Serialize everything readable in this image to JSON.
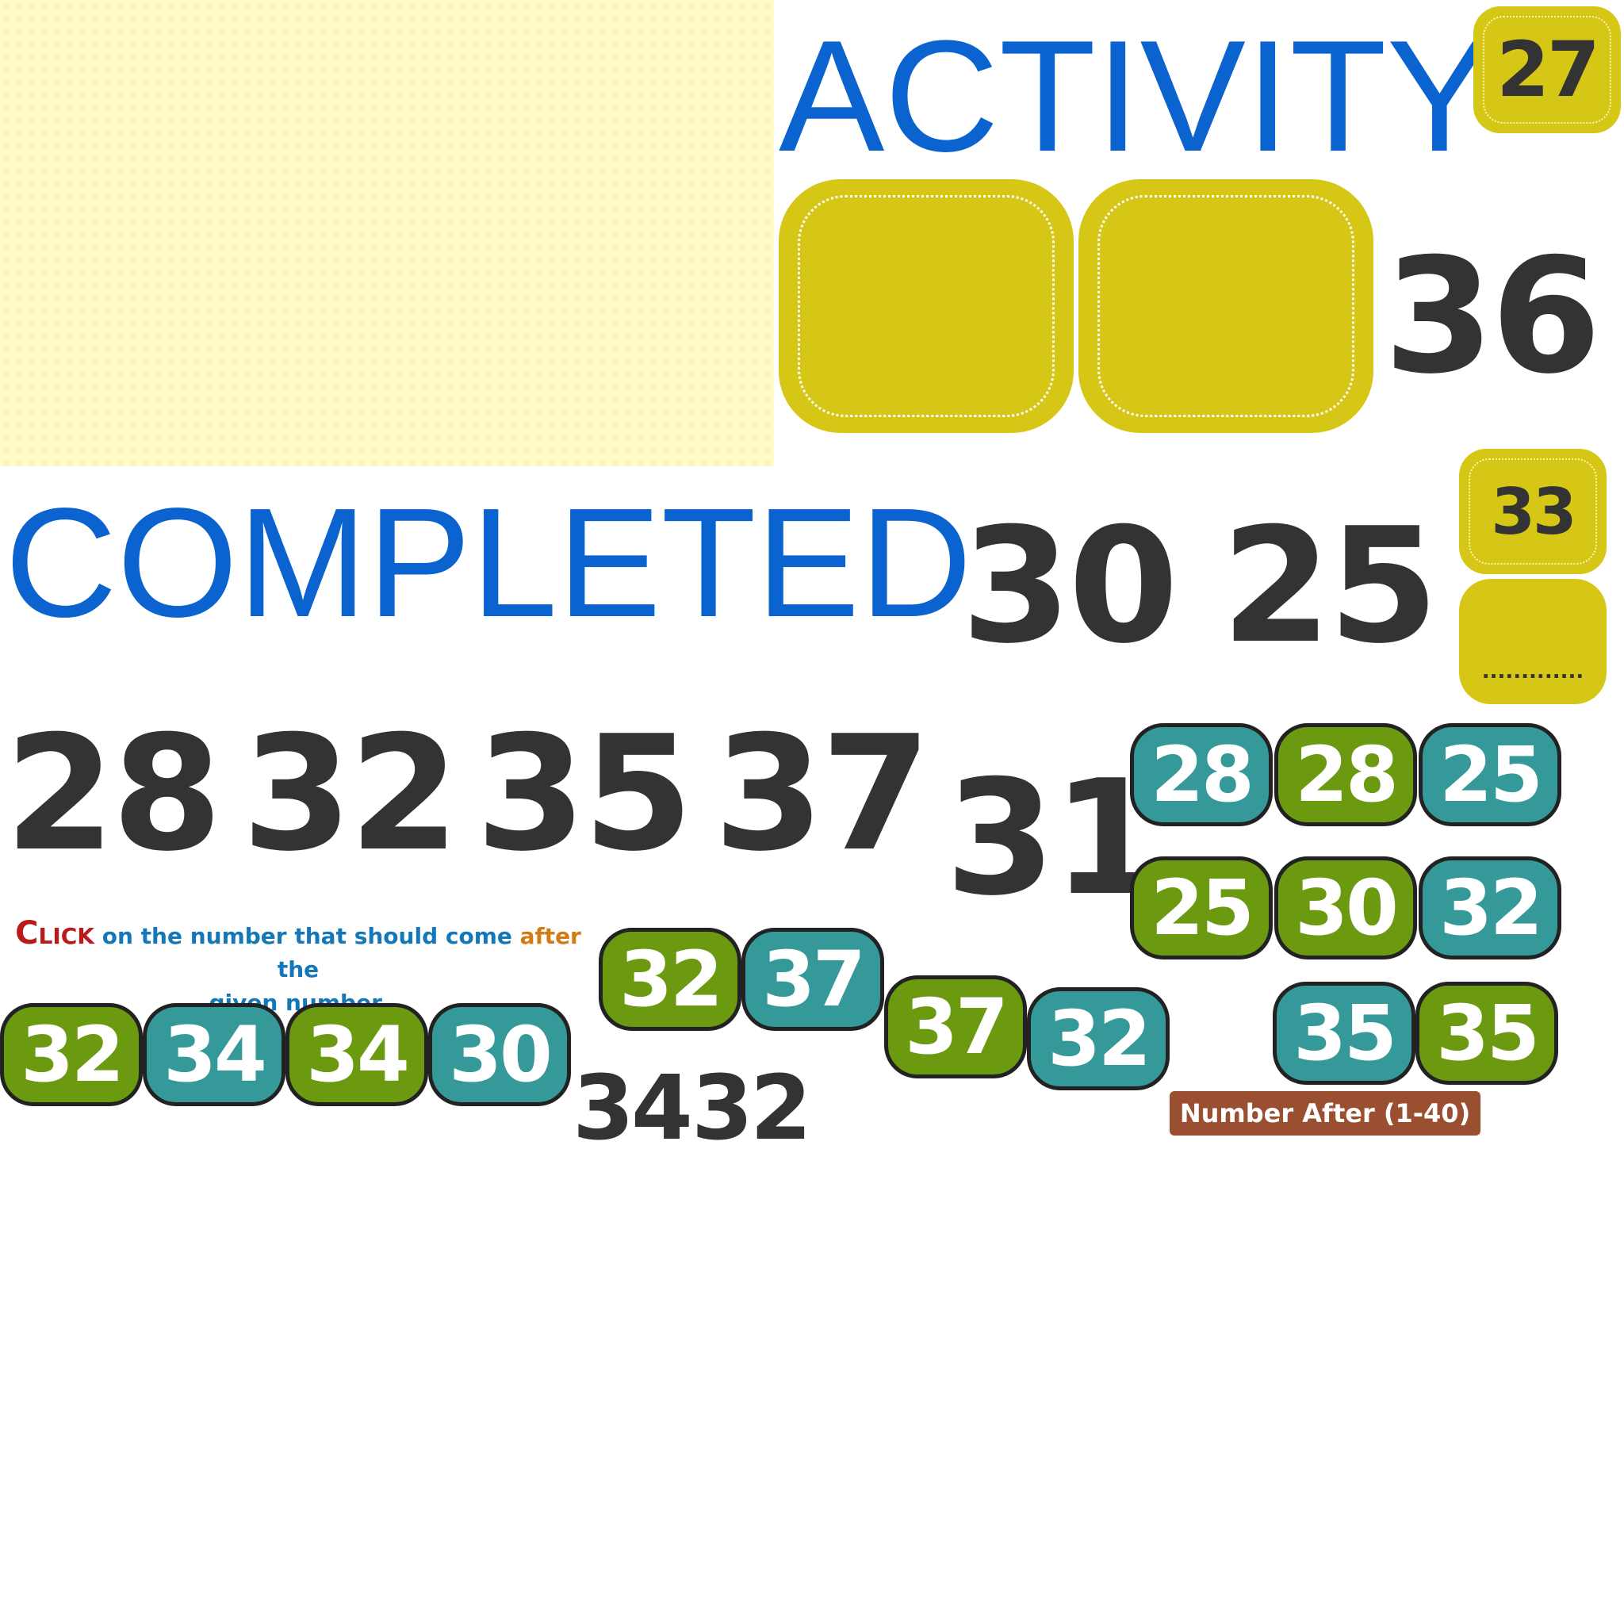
{
  "labels": {
    "activity": "ACTIVITY",
    "completed": "COMPLETED"
  },
  "badges": {
    "activity_number": "27",
    "small_badge": "33",
    "dots_badge": "............."
  },
  "large_numbers": {
    "n36": "36",
    "n30": "30",
    "n25": "25",
    "n28": "28",
    "n32": "32",
    "n35": "35",
    "n37": "37",
    "n31": "31",
    "n34": "34",
    "n32b": "32"
  },
  "tiles": {
    "t1": "28",
    "t2": "28",
    "t3": "25",
    "t4": "25",
    "t5": "30",
    "t6": "32",
    "t7": "32",
    "t8": "37",
    "t9": "37",
    "t10": "32",
    "t11": "35",
    "t12": "35",
    "t13": "32",
    "t14": "34",
    "t15": "34",
    "t16": "30"
  },
  "instruction": {
    "c": "C",
    "lick": "LICK",
    "part1": " on the number that should come ",
    "after": "after",
    "part2": " the",
    "line2": "given number."
  },
  "tag": "Number After (1-40)",
  "colors": {
    "blue_text": "#0b63cf",
    "yellow_box": "#d6c717",
    "teal_tile": "#369999",
    "green_tile": "#6b9a10",
    "dark_number": "#333333",
    "tag_bg": "#9a5030"
  }
}
